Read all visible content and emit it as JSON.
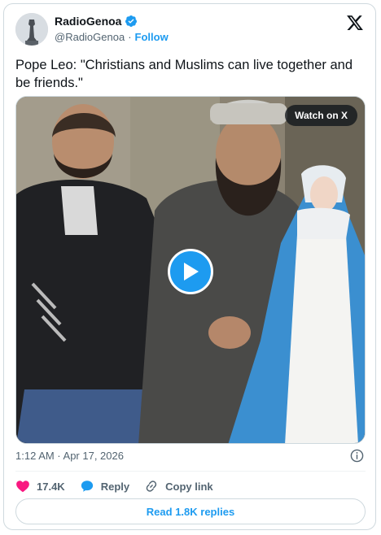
{
  "author": {
    "display_name": "RadioGenoa",
    "handle": "@RadioGenoa",
    "separator": "·",
    "follow_label": "Follow"
  },
  "tweet": {
    "text": "Pope Leo: \"Christians and Muslims can live together and be friends.\"",
    "timestamp": "1:12 AM · Apr 17, 2026"
  },
  "media": {
    "watch_label": "Watch on X"
  },
  "actions": {
    "like_count": "17.4K",
    "reply_label": "Reply",
    "copy_label": "Copy link"
  },
  "read_replies_label": "Read 1.8K replies",
  "colors": {
    "accent": "#1d9bf0",
    "like": "#f91880",
    "text": "#0f1419",
    "muted": "#536471",
    "border": "#cfd9de"
  },
  "icons": [
    "verified-badge-icon",
    "x-logo-icon",
    "play-icon",
    "info-icon",
    "heart-icon",
    "reply-bubble-icon",
    "link-icon"
  ]
}
